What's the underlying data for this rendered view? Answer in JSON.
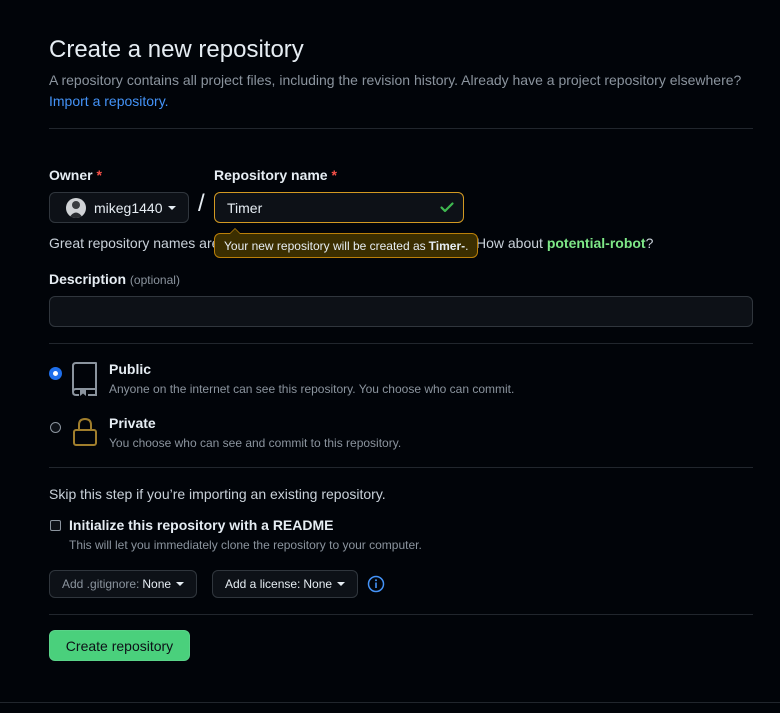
{
  "page": {
    "title": "Create a new repository",
    "subtitle": "A repository contains all project files, including the revision history. Already have a project repository elsewhere?",
    "import_link": "Import a repository."
  },
  "owner": {
    "label": "Owner",
    "required_mark": "*",
    "value": "mikeg1440"
  },
  "separator": "/",
  "repo_name": {
    "label": "Repository name",
    "required_mark": "*",
    "value": "Timer"
  },
  "tooltip": {
    "prefix": "Your new repository will be created as",
    "name": "Timer-",
    "suffix": "."
  },
  "name_hint": {
    "prefix": "Great repository names are",
    "middle": "How about",
    "suggestion": "potential-robot",
    "suffix": "?"
  },
  "description": {
    "label": "Description",
    "optional": "(optional)",
    "value": ""
  },
  "visibility": {
    "options": [
      {
        "title": "Public",
        "desc": "Anyone on the internet can see this repository. You choose who can commit.",
        "selected": true
      },
      {
        "title": "Private",
        "desc": "You choose who can see and commit to this repository.",
        "selected": false
      }
    ]
  },
  "init": {
    "skip_text": "Skip this step if you’re importing an existing repository.",
    "readme_label": "Initialize this repository with a README",
    "readme_desc": "This will let you immediately clone the repository to your computer.",
    "readme_checked": false
  },
  "gitignore": {
    "label": "Add .gitignore:",
    "value": "None"
  },
  "license": {
    "label": "Add a license:",
    "value": "None"
  },
  "submit_label": "Create repository",
  "colors": {
    "accent_blue": "#4493f8",
    "success_green": "#4ad07c",
    "warning_border": "#d29922",
    "suggestion_green": "#7ee787"
  },
  "icons": [
    "check-icon",
    "repo-icon",
    "lock-icon",
    "info-icon",
    "avatar"
  ]
}
